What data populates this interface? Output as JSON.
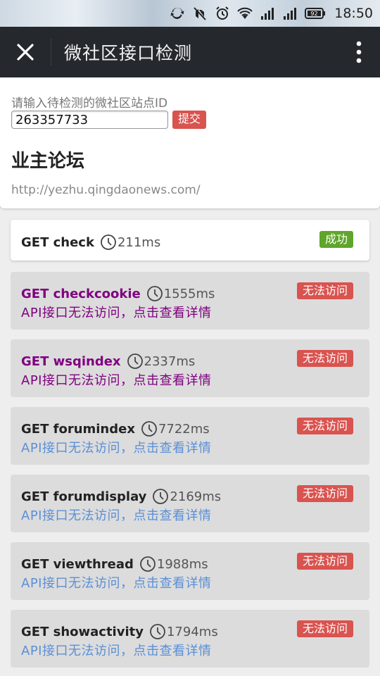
{
  "status_bar": {
    "battery": "92",
    "time": "18:50",
    "icons": [
      "sync-icon",
      "mute-icon",
      "alarm-icon",
      "wifi-icon",
      "signal-icon",
      "signal-icon",
      "battery-icon"
    ]
  },
  "header": {
    "title": "微社区接口检测",
    "close_icon": "close-icon",
    "more_icon": "more-vertical-icon"
  },
  "form": {
    "prompt": "请输入待检测的微社区站点ID",
    "site_id": "263357733",
    "submit_label": "提交"
  },
  "site": {
    "name": "业主论坛",
    "url": "http://yezhu.qingdaonews.com/"
  },
  "results": [
    {
      "method": "GET check",
      "time": "211ms",
      "status": "成功",
      "detail": ""
    },
    {
      "method": "GET checkcookie",
      "time": "1555ms",
      "status": "无法访问",
      "detail": "API接口无法访问，点击查看详情"
    },
    {
      "method": "GET wsqindex",
      "time": "2337ms",
      "status": "无法访问",
      "detail": "API接口无法访问，点击查看详情"
    },
    {
      "method": "GET forumindex",
      "time": "7722ms",
      "status": "无法访问",
      "detail": "API接口无法访问，点击查看详情"
    },
    {
      "method": "GET forumdisplay",
      "time": "2169ms",
      "status": "无法访问",
      "detail": "API接口无法访问，点击查看详情"
    },
    {
      "method": "GET viewthread",
      "time": "1988ms",
      "status": "无法访问",
      "detail": "API接口无法访问，点击查看详情"
    },
    {
      "method": "GET showactivity",
      "time": "1794ms",
      "status": "无法访问",
      "detail": "API接口无法访问，点击查看详情"
    }
  ],
  "colors": {
    "header_bg": "#25292d",
    "fail_badge": "#d9534f",
    "success_badge": "#5fa52a",
    "link": "#5b8fd6",
    "visited_link": "#800080"
  }
}
